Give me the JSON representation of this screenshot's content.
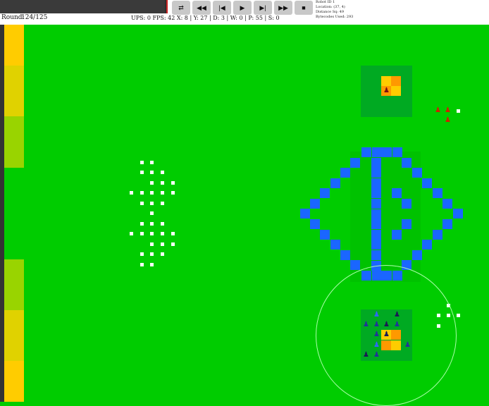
{
  "controls": {
    "progress_fraction": 0.99,
    "buttons": [
      {
        "name": "swap-button",
        "icon": "swap-icon",
        "glyph": "⇄"
      },
      {
        "name": "rewind-button",
        "icon": "rewind-icon",
        "glyph": "◀◀"
      },
      {
        "name": "step-back-button",
        "icon": "step-back-icon",
        "glyph": "|◀"
      },
      {
        "name": "play-button",
        "icon": "play-icon",
        "glyph": "▶"
      },
      {
        "name": "step-forward-button",
        "icon": "step-forward-icon",
        "glyph": "▶|"
      },
      {
        "name": "fast-forward-button",
        "icon": "fast-forward-icon",
        "glyph": "▶▶"
      },
      {
        "name": "stop-button",
        "icon": "stop-icon",
        "glyph": "■"
      }
    ]
  },
  "round": {
    "label": "Round:",
    "value": "124/125"
  },
  "stats": {
    "ups": "UPS: 0",
    "fps": "FPS: 42",
    "x": "X: 8",
    "y": "Y: 27",
    "d": "D: 3",
    "w": "W: 0",
    "p": "P: 55",
    "s": "S: 0"
  },
  "robot_info": {
    "id": "Robot ID 1",
    "location": "Location: (37, 4)",
    "distance": "Distance Sq: 49",
    "bytecodes": "Bytecodes Used: 293"
  },
  "colors": {
    "field": "#00cc00",
    "dark_grass": "#00aa22",
    "wall": "#1a66ff",
    "gold": "#ffcc00",
    "orange": "#ff9900",
    "red_team": "#cc2200",
    "blue_team": "#2255cc",
    "marker": "#ffffff"
  },
  "left_strip": [
    {
      "color": "#ffcc00",
      "from": 0,
      "to": 58
    },
    {
      "color": "#e0d200",
      "from": 58,
      "to": 130
    },
    {
      "color": "#99d400",
      "from": 130,
      "to": 203
    },
    {
      "color": "#00cc00",
      "from": 203,
      "to": 333
    },
    {
      "color": "#99d400",
      "from": 333,
      "to": 405
    },
    {
      "color": "#e0d200",
      "from": 405,
      "to": 477
    },
    {
      "color": "#ffcc00",
      "from": 477,
      "to": 535
    }
  ],
  "robots": {
    "red": [
      {
        "glyph": "♟",
        "type": "red-robot-icon"
      },
      {
        "glyph": "♟",
        "type": "red-robot-icon"
      },
      {
        "glyph": "♟",
        "type": "red-robot-icon"
      }
    ],
    "blue": [
      {
        "glyph": "♟",
        "type": "blue-robot-icon"
      },
      {
        "glyph": "♟",
        "type": "blue-robot-icon"
      },
      {
        "glyph": "♟",
        "type": "blue-robot-icon"
      },
      {
        "glyph": "♟",
        "type": "blue-robot-icon"
      },
      {
        "glyph": "♟",
        "type": "blue-robot-icon"
      },
      {
        "glyph": "♟",
        "type": "blue-robot-icon"
      },
      {
        "glyph": "♟",
        "type": "blue-robot-icon"
      },
      {
        "glyph": "♟",
        "type": "blue-robot-icon"
      },
      {
        "glyph": "♟",
        "type": "blue-robot-icon"
      },
      {
        "glyph": "♟",
        "type": "blue-robot-icon"
      },
      {
        "glyph": "♟",
        "type": "blue-robot-icon"
      },
      {
        "glyph": "♟",
        "type": "blue-robot-icon"
      }
    ]
  }
}
